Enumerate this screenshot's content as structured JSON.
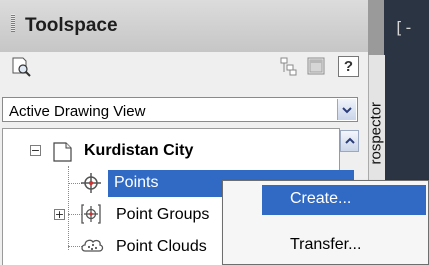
{
  "panel": {
    "title": "Toolspace",
    "side_tab": "rospector"
  },
  "toolbar": {
    "help_label": "?"
  },
  "view_selector": {
    "selected": "Active Drawing View"
  },
  "viewport": {
    "visible_text": "[-"
  },
  "tree": {
    "root": {
      "label": "Kurdistan City",
      "expander": "−"
    },
    "items": [
      {
        "label": "Points"
      },
      {
        "label": "Point Groups",
        "expander": "+"
      },
      {
        "label": "Point Clouds"
      }
    ]
  },
  "context_menu": {
    "items": [
      {
        "label": "Create..."
      },
      {
        "label": "Transfer..."
      }
    ]
  },
  "colors": {
    "selection": "#316ac5",
    "viewport_bg": "#2a3442"
  }
}
